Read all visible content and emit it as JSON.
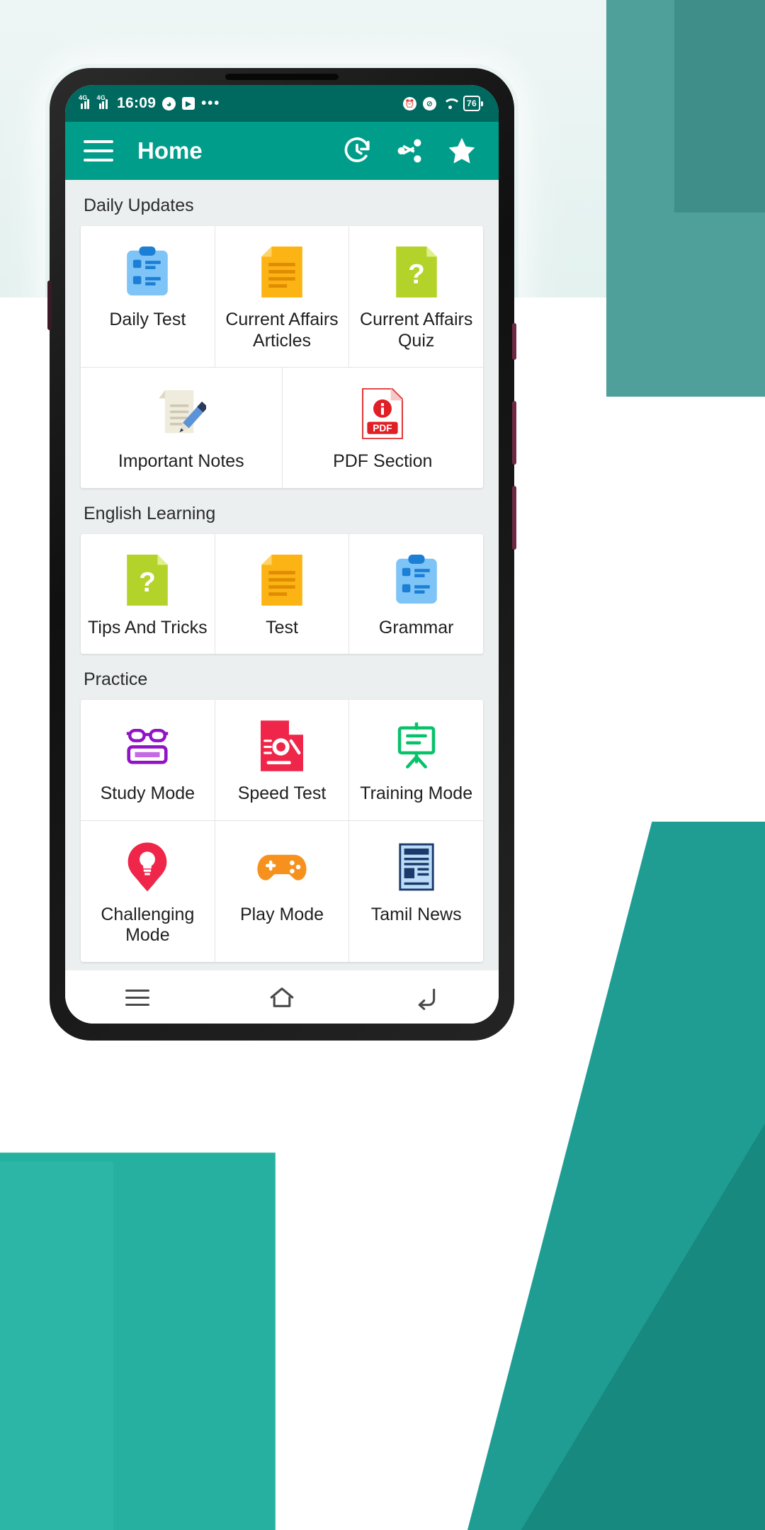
{
  "status_bar": {
    "time": "16:09",
    "battery_percent": "76",
    "icons": [
      "signal-4g-icon",
      "signal-4g-icon",
      "clock-icon",
      "play-store-icon",
      "ellipsis-icon",
      "alarm-icon",
      "vibrate-icon",
      "wifi-icon",
      "battery-icon"
    ]
  },
  "app_bar": {
    "title": "Home",
    "menu_icon": "hamburger-menu-icon",
    "actions": [
      {
        "name": "history-icon",
        "label": "History"
      },
      {
        "name": "share-icon",
        "label": "Share"
      },
      {
        "name": "star-icon",
        "label": "Favourite"
      }
    ]
  },
  "sections": [
    {
      "title": "Daily Updates",
      "rows": [
        [
          {
            "label": "Daily Test",
            "icon": "clipboard-checklist-icon"
          },
          {
            "label": "Current Affairs Articles",
            "icon": "orange-document-icon"
          },
          {
            "label": "Current Affairs Quiz",
            "icon": "green-question-document-icon"
          }
        ],
        [
          {
            "label": "Important Notes",
            "icon": "note-with-pencil-icon"
          },
          {
            "label": "PDF Section",
            "icon": "pdf-file-icon"
          }
        ]
      ]
    },
    {
      "title": "English Learning",
      "rows": [
        [
          {
            "label": "Tips And Tricks",
            "icon": "green-question-document-icon"
          },
          {
            "label": "Test",
            "icon": "orange-document-icon"
          },
          {
            "label": "Grammar",
            "icon": "clipboard-checklist-icon"
          }
        ]
      ]
    },
    {
      "title": "Practice",
      "rows": [
        [
          {
            "label": "Study Mode",
            "icon": "book-glasses-icon"
          },
          {
            "label": "Speed Test",
            "icon": "speed-document-icon"
          },
          {
            "label": "Training Mode",
            "icon": "presentation-board-icon"
          }
        ],
        [
          {
            "label": "Challenging Mode",
            "icon": "brain-bulb-icon"
          },
          {
            "label": "Play Mode",
            "icon": "gamepad-icon"
          },
          {
            "label": "Tamil News",
            "icon": "newspaper-icon"
          }
        ]
      ]
    }
  ],
  "nav_bar": {
    "buttons": [
      {
        "name": "recents-button",
        "icon": "menu-lines-icon"
      },
      {
        "name": "home-button",
        "icon": "home-outline-icon"
      },
      {
        "name": "back-button",
        "icon": "back-arrow-icon"
      }
    ]
  },
  "colors": {
    "status_bar": "#00695f",
    "app_bar": "#009e8a",
    "content_bg": "#eceff0",
    "card_bg": "#ffffff",
    "text": "#1f1f1f"
  }
}
